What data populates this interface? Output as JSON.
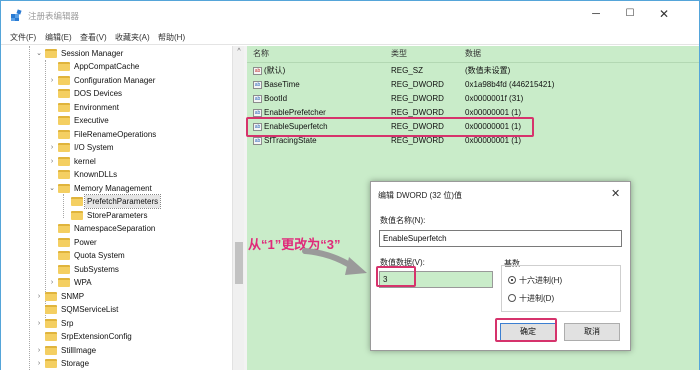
{
  "window": {
    "title": "注册表编辑器",
    "minimize_glyph": "─",
    "maximize_glyph": "☐",
    "close_glyph": "✕"
  },
  "menu": [
    "文件(F)",
    "编辑(E)",
    "查看(V)",
    "收藏夹(A)",
    "帮助(H)"
  ],
  "tree": {
    "items": [
      {
        "label": "Session Manager",
        "expander": "⌄"
      },
      {
        "label": "AppCompatCache",
        "expander": ""
      },
      {
        "label": "Configuration Manager",
        "expander": "›"
      },
      {
        "label": "DOS Devices",
        "expander": ""
      },
      {
        "label": "Environment",
        "expander": ""
      },
      {
        "label": "Executive",
        "expander": ""
      },
      {
        "label": "FileRenameOperations",
        "expander": ""
      },
      {
        "label": "I/O System",
        "expander": "›"
      },
      {
        "label": "kernel",
        "expander": "›"
      },
      {
        "label": "KnownDLLs",
        "expander": ""
      },
      {
        "label": "Memory Management",
        "expander": "⌄"
      },
      {
        "label": "PrefetchParameters",
        "expander": ""
      },
      {
        "label": "StoreParameters",
        "expander": ""
      },
      {
        "label": "NamespaceSeparation",
        "expander": ""
      },
      {
        "label": "Power",
        "expander": ""
      },
      {
        "label": "Quota System",
        "expander": ""
      },
      {
        "label": "SubSystems",
        "expander": ""
      },
      {
        "label": "WPA",
        "expander": "›"
      },
      {
        "label": "SNMP",
        "expander": "›"
      },
      {
        "label": "SQMServiceList",
        "expander": ""
      },
      {
        "label": "Srp",
        "expander": "›"
      },
      {
        "label": "SrpExtensionConfig",
        "expander": ""
      },
      {
        "label": "StillImage",
        "expander": "›"
      },
      {
        "label": "Storage",
        "expander": "›"
      }
    ],
    "scroll_up_glyph": "^"
  },
  "values_pane": {
    "headers": {
      "name": "名称",
      "type": "类型",
      "data": "数据"
    },
    "rows": [
      {
        "icon": "ab",
        "name": "(默认)",
        "type": "REG_SZ",
        "data": "(数值未设置)"
      },
      {
        "icon": "ab",
        "name": "BaseTime",
        "type": "REG_DWORD",
        "data": "0x1a98b4fd (446215421)"
      },
      {
        "icon": "ab",
        "name": "BootId",
        "type": "REG_DWORD",
        "data": "0x0000001f (31)"
      },
      {
        "icon": "ab",
        "name": "EnablePrefetcher",
        "type": "REG_DWORD",
        "data": "0x00000001 (1)"
      },
      {
        "icon": "ab",
        "name": "EnableSuperfetch",
        "type": "REG_DWORD",
        "data": "0x00000001 (1)"
      },
      {
        "icon": "ab",
        "name": "SfTracingState",
        "type": "REG_DWORD",
        "data": "0x00000001 (1)"
      }
    ]
  },
  "dialog": {
    "title": "编辑 DWORD (32 位)值",
    "close_glyph": "✕",
    "name_label": "数值名称(N):",
    "name_value": "EnableSuperfetch",
    "data_label": "数值数据(V):",
    "data_value": "3",
    "radix_label": "基数",
    "radix_hex": "十六进制(H)",
    "radix_dec": "十进制(D)",
    "ok": "确定",
    "cancel": "取消"
  },
  "annotation": {
    "text": "从“1”更改为“3”",
    "color": "#e0297a"
  },
  "colors": {
    "highlight_border": "#d6336c",
    "values_bg": "#c9ecc9",
    "window_border": "#55a5d9"
  }
}
